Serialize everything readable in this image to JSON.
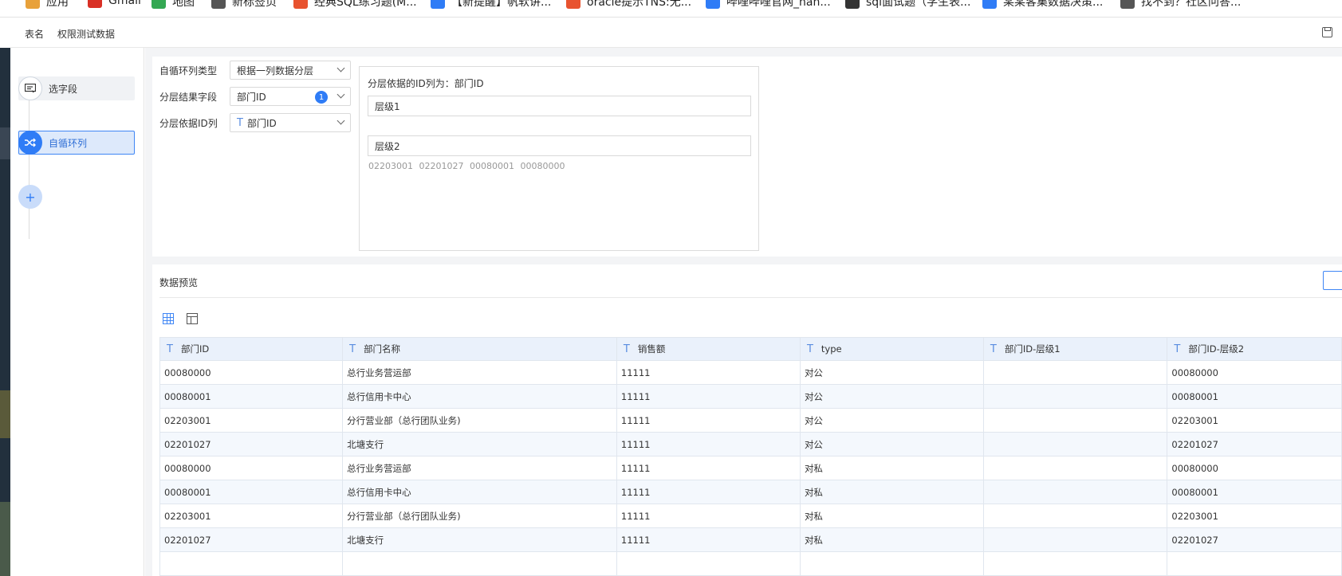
{
  "bookmarks": [
    {
      "label": "应用",
      "color": "#e8a13a"
    },
    {
      "label": "Gmail",
      "color": "#d93025"
    },
    {
      "label": "地图",
      "color": "#34a853"
    },
    {
      "label": "新标签页",
      "color": "#555555"
    },
    {
      "label": "经典SQL练习题(M...",
      "color": "#e8532f"
    },
    {
      "label": "【新提醒】帆软讲...",
      "color": "#2f7cf6"
    },
    {
      "label": "oracle提示TNS:无...",
      "color": "#e8532f"
    },
    {
      "label": "哔哩哔哩官网_hah...",
      "color": "#2f7cf6"
    },
    {
      "label": "sql面试题（学生表...",
      "color": "#333333"
    },
    {
      "label": "某某客集数据决策...",
      "color": "#2f7cf6"
    },
    {
      "label": "找不到？社区问答...",
      "color": "#555555"
    }
  ],
  "tabs": {
    "table_name": "表名",
    "dataset_name": "权限测试数据"
  },
  "steps": [
    {
      "label": "选字段",
      "icon": "select-field-icon",
      "active": false
    },
    {
      "label": "自循环列",
      "icon": "shuffle-icon",
      "active": true
    }
  ],
  "add_step": "+",
  "config": {
    "type_label": "自循环列类型",
    "type_value": "根据一列数据分层",
    "result_label": "分层结果字段",
    "result_value": "部门ID",
    "result_badge": "1",
    "id_label": "分层依据ID列",
    "id_value": "部门ID",
    "layer_box_title": "分层依据的ID列为：部门ID",
    "layers": [
      "层级1",
      "层级2"
    ],
    "layer2_ids": "02203001 02201027 00080001 00080000"
  },
  "preview": {
    "title": "数据预览",
    "columns": [
      "部门ID",
      "部门名称",
      "销售额",
      "type",
      "部门ID-层级1",
      "部门ID-层级2"
    ],
    "rows": [
      [
        "00080000",
        "总行业务营运部",
        "11111",
        "对公",
        "",
        "00080000"
      ],
      [
        "00080001",
        "总行信用卡中心",
        "11111",
        "对公",
        "",
        "00080001"
      ],
      [
        "02203001",
        "分行营业部（总行团队业务)",
        "11111",
        "对公",
        "",
        "02203001"
      ],
      [
        "02201027",
        "北塘支行",
        "11111",
        "对公",
        "",
        "02201027"
      ],
      [
        "00080000",
        "总行业务营运部",
        "11111",
        "对私",
        "",
        "00080000"
      ],
      [
        "00080001",
        "总行信用卡中心",
        "11111",
        "对私",
        "",
        "00080001"
      ],
      [
        "02203001",
        "分行营业部（总行团队业务)",
        "11111",
        "对私",
        "",
        "02203001"
      ],
      [
        "02201027",
        "北塘支行",
        "11111",
        "对私",
        "",
        "02201027"
      ]
    ]
  },
  "colors": {
    "accent": "#2f7cf6",
    "header_bg": "#eaf1fb"
  }
}
